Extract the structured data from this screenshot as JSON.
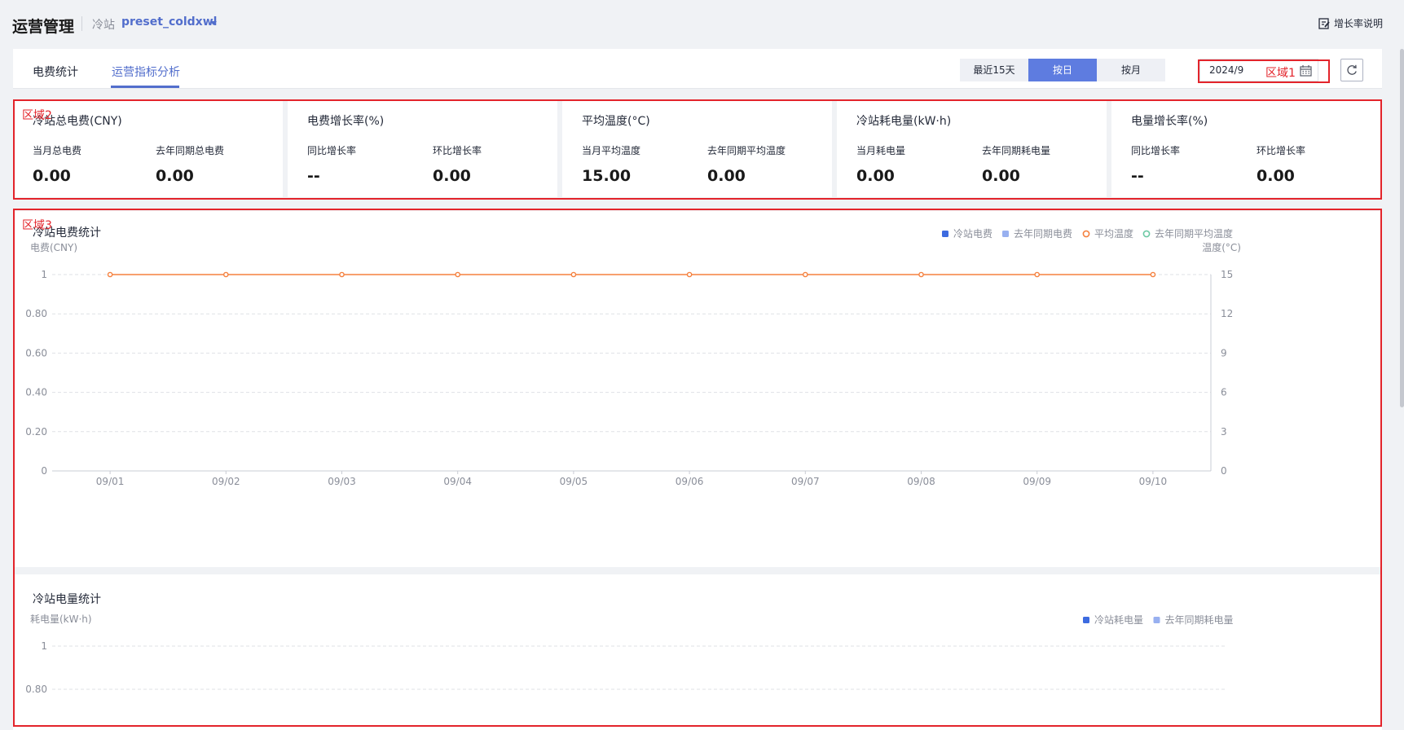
{
  "header": {
    "title": "运营管理",
    "station_label": "冷站",
    "station_name": "preset_coldxwl",
    "help_label": "增长率说明"
  },
  "tabs": [
    {
      "label": "电费统计",
      "active": false
    },
    {
      "label": "运营指标分析",
      "active": true
    }
  ],
  "range_buttons": [
    {
      "label": "最近15天",
      "active": false
    },
    {
      "label": "按日",
      "active": true
    },
    {
      "label": "按月",
      "active": false
    }
  ],
  "date_picker": {
    "value": "2024/9"
  },
  "regions": {
    "r1": "区域1",
    "r2": "区域2",
    "r3": "区域3"
  },
  "kpis": [
    {
      "title": "冷站总电费(CNY)",
      "sub1": "当月总电费",
      "val1": "0.00",
      "sub2": "去年同期总电费",
      "val2": "0.00"
    },
    {
      "title": "电费增长率(%)",
      "sub1": "同比增长率",
      "val1": "--",
      "sub2": "环比增长率",
      "val2": "0.00"
    },
    {
      "title": "平均温度(°C)",
      "sub1": "当月平均温度",
      "val1": "15.00",
      "sub2": "去年同期平均温度",
      "val2": "0.00"
    },
    {
      "title": "冷站耗电量(kW·h)",
      "sub1": "当月耗电量",
      "val1": "0.00",
      "sub2": "去年同期耗电量",
      "val2": "0.00"
    },
    {
      "title": "电量增长率(%)",
      "sub1": "同比增长率",
      "val1": "--",
      "sub2": "环比增长率",
      "val2": "0.00"
    }
  ],
  "fee_panel": {
    "title": "冷站电费统计"
  },
  "energy_panel": {
    "title": "冷站电量统计"
  },
  "chart_data": [
    {
      "type": "line",
      "title": "冷站电费统计",
      "ylabel": "电费(CNY)",
      "y2label": "温度(°C)",
      "categories": [
        "09/01",
        "09/02",
        "09/03",
        "09/04",
        "09/05",
        "09/06",
        "09/07",
        "09/08",
        "09/09",
        "09/10"
      ],
      "ylim": [
        0,
        1
      ],
      "y_ticks": [
        "0",
        "0.20",
        "0.40",
        "0.60",
        "0.80",
        "1"
      ],
      "y2lim": [
        0,
        15
      ],
      "y2_ticks": [
        "0",
        "3",
        "6",
        "9",
        "12",
        "15"
      ],
      "grid": true,
      "legend_position": "top-right",
      "series": [
        {
          "name": "冷站电费",
          "axis": "left",
          "type": "bar",
          "color": "#3d6be0",
          "values": []
        },
        {
          "name": "去年同期电费",
          "axis": "left",
          "type": "bar",
          "color": "#98b0f0",
          "values": []
        },
        {
          "name": "平均温度",
          "axis": "right",
          "type": "line",
          "color": "#f5813f",
          "values": [
            15,
            15,
            15,
            15,
            15,
            15,
            15,
            15,
            15,
            15
          ]
        },
        {
          "name": "去年同期平均温度",
          "axis": "right",
          "type": "line",
          "color": "#6cc9a4",
          "values": []
        }
      ]
    },
    {
      "type": "bar",
      "title": "冷站电量统计",
      "ylabel": "耗电量(kW·h)",
      "y_ticks": [
        "1",
        "0.80"
      ],
      "ylim": [
        0,
        1
      ],
      "grid": true,
      "legend_position": "top-right",
      "series": [
        {
          "name": "冷站耗电量",
          "color": "#3d6be0",
          "values": []
        },
        {
          "name": "去年同期耗电量",
          "color": "#98b0f0",
          "values": []
        }
      ]
    }
  ]
}
